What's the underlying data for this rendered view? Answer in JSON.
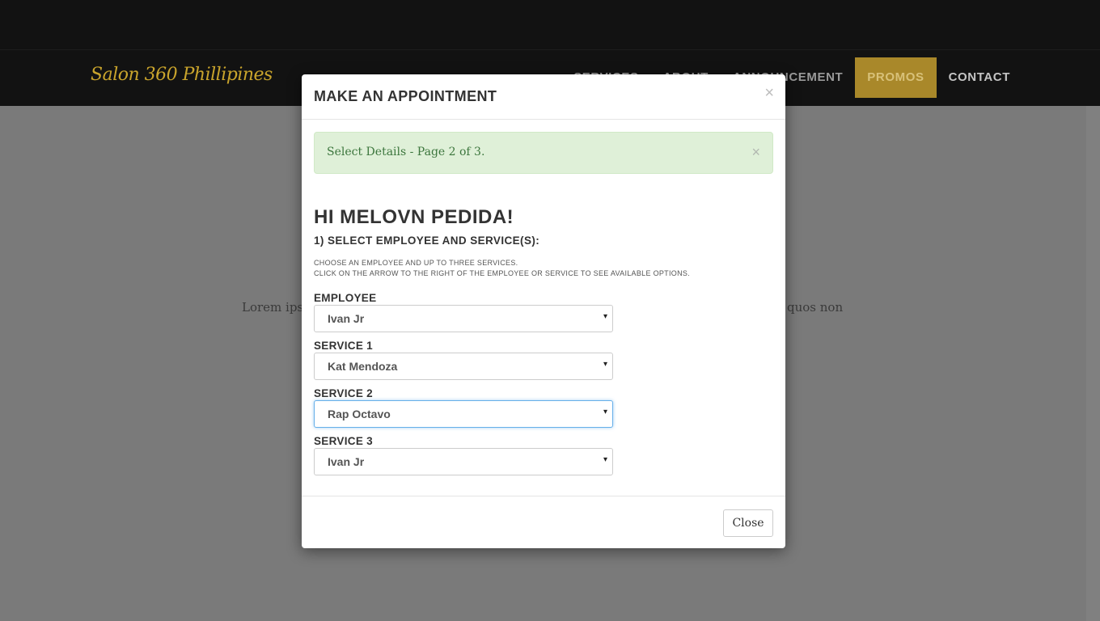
{
  "site": {
    "brand": "Salon 360 Phillipines",
    "nav": [
      {
        "label": "SERVICES"
      },
      {
        "label": "ABOUT"
      },
      {
        "label": "ANNOUNCEMENT"
      },
      {
        "label": "PROMOS"
      },
      {
        "label": "CONTACT"
      }
    ],
    "lorem_left": "Lorem ips",
    "lorem_right": "quos non"
  },
  "modal": {
    "title": "MAKE AN APPOINTMENT",
    "close_icon": "×",
    "alert": {
      "text": "Select Details - Page 2 of 3.",
      "close_icon": "×"
    },
    "greeting": "HI MELOVN PEDIDA!",
    "step_title": "1) SELECT EMPLOYEE AND SERVICE(S):",
    "help_line1": "CHOOSE AN EMPLOYEE AND UP TO THREE SERVICES.",
    "help_line2": "CLICK ON THE ARROW TO THE RIGHT OF THE EMPLOYEE OR SERVICE TO SEE AVAILABLE OPTIONS.",
    "fields": [
      {
        "label": "EMPLOYEE",
        "value": "Ivan Jr"
      },
      {
        "label": "SERVICE 1",
        "value": "Kat Mendoza"
      },
      {
        "label": "SERVICE 2",
        "value": "Rap Octavo"
      },
      {
        "label": "SERVICE 3",
        "value": "Ivan Jr"
      }
    ],
    "select_arrow": "▾",
    "close_button": "Close"
  },
  "colors": {
    "brand": "#c9a42c",
    "promo_active_bg": "#a9882a",
    "alert_bg": "#dff0d8",
    "alert_text": "#3c763d",
    "focus_border": "#66afe9"
  }
}
